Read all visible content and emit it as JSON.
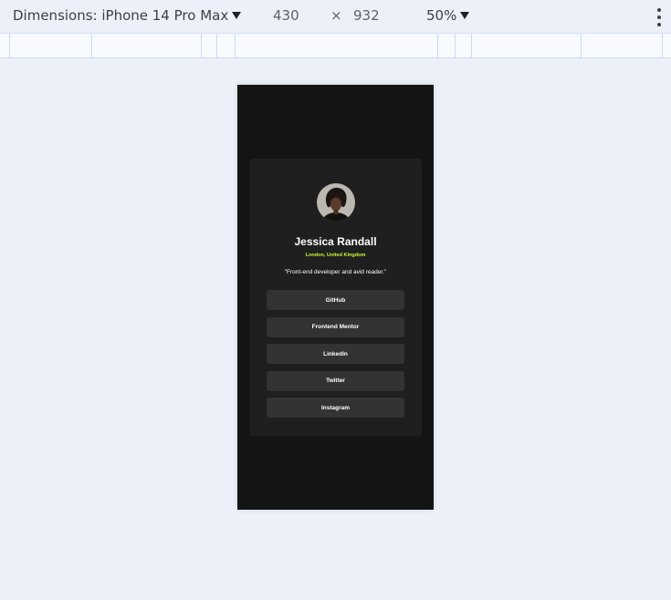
{
  "toolbar": {
    "device_label": "Dimensions: iPhone 14 Pro Max",
    "width": "430",
    "times": "×",
    "height": "932",
    "zoom": "50%"
  },
  "profile": {
    "name": "Jessica Randall",
    "location": "London, United Kingdom",
    "bio": "\"Front-end developer and avid reader.\"",
    "links": [
      "GitHub",
      "Frontend Mentor",
      "LinkedIn",
      "Twitter",
      "Instagram"
    ]
  },
  "colors": {
    "page_bg": "#141414",
    "card_bg": "#1f1f1f",
    "button_bg": "#333333",
    "accent_green": "#c4f82a"
  }
}
